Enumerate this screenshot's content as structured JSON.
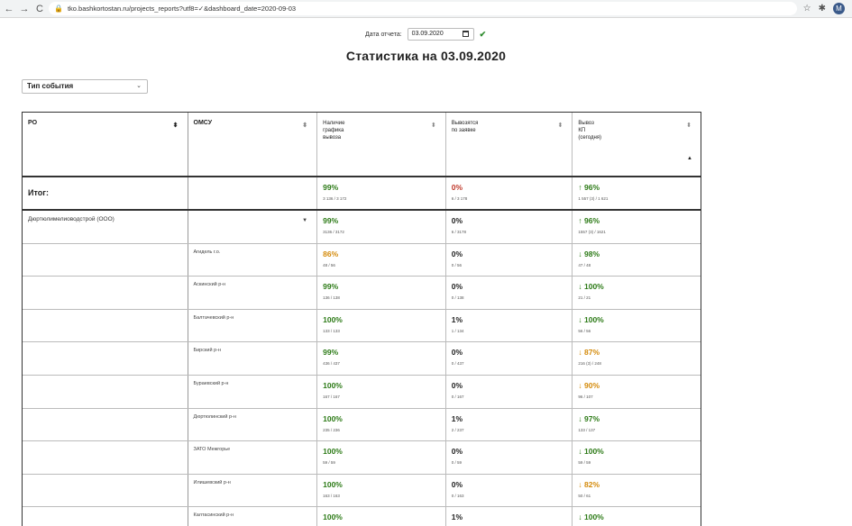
{
  "browser": {
    "url": "tko.bashkortostan.ru/projects_reports?utf8=✓&dashboard_date=2020-09-03",
    "avatar_letter": "M"
  },
  "date_filter": {
    "label": "Дата отчета:",
    "value": "03.09.2020"
  },
  "page_title": "Статистика на 03.09.2020",
  "event_select": {
    "value": "Тип события"
  },
  "table": {
    "headers": {
      "ro": "РО",
      "omsu": "ОМСУ",
      "schedule": [
        "Наличие",
        "графика",
        "вывоза"
      ],
      "on_request": [
        "Вывозятся",
        "по заявке"
      ],
      "kp": [
        "Вывоз",
        "КП",
        "(сегодня)"
      ]
    },
    "total": {
      "label": "Итог:",
      "schedule": {
        "pct": "99%",
        "sub": "3 136 / 3 172"
      },
      "on_request": {
        "pct": "0%",
        "sub": "6 / 3 178"
      },
      "kp": {
        "pct": "↑ 96%",
        "sub": "1 557 (3) / 1 621"
      }
    },
    "ro_name": "Дюртюлимелиоводстрой (ООО)",
    "rows": [
      {
        "omsu": "",
        "schedule": {
          "pct": "99%",
          "sub": "3136 / 3172",
          "color": "green"
        },
        "on_request": {
          "pct": "0%",
          "sub": "6 / 3178"
        },
        "kp": {
          "pct": "↑ 96%",
          "sub": "1557 (3) / 1621",
          "color": "green"
        }
      },
      {
        "omsu": "Агидель г.о.",
        "schedule": {
          "pct": "86%",
          "sub": "48 / 56",
          "color": "orange"
        },
        "on_request": {
          "pct": "0%",
          "sub": "0 / 56"
        },
        "kp": {
          "pct": "↓ 98%",
          "sub": "47 / 48",
          "color": "green"
        }
      },
      {
        "omsu": "Аскинский р-н",
        "schedule": {
          "pct": "99%",
          "sub": "136 / 138",
          "color": "green"
        },
        "on_request": {
          "pct": "0%",
          "sub": "0 / 138"
        },
        "kp": {
          "pct": "↓ 100%",
          "sub": "21 / 21",
          "color": "green"
        }
      },
      {
        "omsu": "Балтачевский р-н",
        "schedule": {
          "pct": "100%",
          "sub": "133 / 133",
          "color": "green"
        },
        "on_request": {
          "pct": "1%",
          "sub": "1 / 134"
        },
        "kp": {
          "pct": "↓ 100%",
          "sub": "56 / 56",
          "color": "green"
        }
      },
      {
        "omsu": "Бирский р-н",
        "schedule": {
          "pct": "99%",
          "sub": "436 / 437",
          "color": "green"
        },
        "on_request": {
          "pct": "0%",
          "sub": "0 / 437"
        },
        "kp": {
          "pct": "↓ 87%",
          "sub": "216 (3) / 248",
          "color": "orange"
        }
      },
      {
        "omsu": "Бураевский р-н",
        "schedule": {
          "pct": "100%",
          "sub": "167 / 167",
          "color": "green"
        },
        "on_request": {
          "pct": "0%",
          "sub": "0 / 167"
        },
        "kp": {
          "pct": "↓ 90%",
          "sub": "96 / 107",
          "color": "orange"
        }
      },
      {
        "omsu": "Дюртюлинский р-н",
        "schedule": {
          "pct": "100%",
          "sub": "235 / 236",
          "color": "green"
        },
        "on_request": {
          "pct": "1%",
          "sub": "2 / 237"
        },
        "kp": {
          "pct": "↓ 97%",
          "sub": "133 / 137",
          "color": "green"
        }
      },
      {
        "omsu": "ЗАТО Межгорье",
        "schedule": {
          "pct": "100%",
          "sub": "59 / 59",
          "color": "green"
        },
        "on_request": {
          "pct": "0%",
          "sub": "0 / 59"
        },
        "kp": {
          "pct": "↓ 100%",
          "sub": "59 / 59",
          "color": "green"
        }
      },
      {
        "omsu": "Илишевский р-н",
        "schedule": {
          "pct": "100%",
          "sub": "163 / 163",
          "color": "green"
        },
        "on_request": {
          "pct": "0%",
          "sub": "0 / 163"
        },
        "kp": {
          "pct": "↓ 82%",
          "sub": "50 / 61",
          "color": "orange"
        }
      },
      {
        "omsu": "Калтасинский р-н",
        "schedule": {
          "pct": "100%",
          "sub": "",
          "color": "green"
        },
        "on_request": {
          "pct": "1%",
          "sub": ""
        },
        "kp": {
          "pct": "↓ 100%",
          "sub": "",
          "color": "green"
        }
      }
    ]
  }
}
